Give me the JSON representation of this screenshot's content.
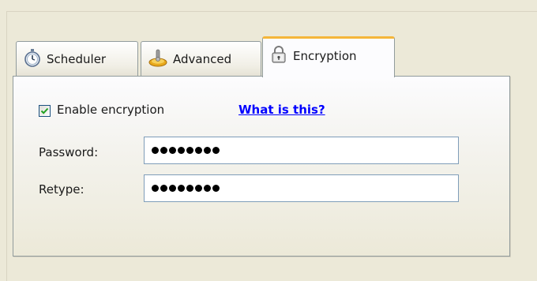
{
  "tabs": [
    {
      "label": "Scheduler",
      "icon": "stopwatch-icon"
    },
    {
      "label": "Advanced",
      "icon": "joystick-icon"
    },
    {
      "label": "Encryption",
      "icon": "padlock-icon",
      "selected": true
    }
  ],
  "encryption": {
    "enable_label": "Enable encryption",
    "enable_checked": true,
    "help_link": "What is this?",
    "password_label": "Password:",
    "password_value": "••••••••",
    "retype_label": "Retype:",
    "retype_value": "••••••••"
  },
  "colors": {
    "selected_tab_accent": "#f5b63a",
    "link": "#0000ff",
    "checkmark": "#21a121",
    "input_border": "#7f9db9"
  }
}
